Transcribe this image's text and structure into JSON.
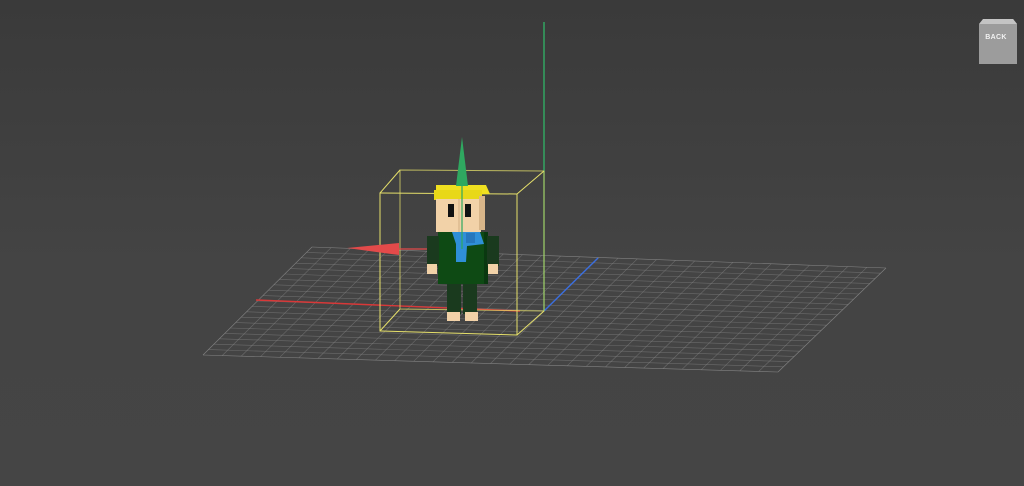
{
  "viewcube": {
    "face_label": "BACK"
  },
  "scene": {
    "character": "blocky-boy-character",
    "colors": {
      "background": "#414141",
      "grid": "#8a8a8a",
      "x_axis": "#e03a3a",
      "y_axis": "#3a6ee0",
      "z_axis": "#2fbf6a",
      "selection_box": "#e6e06a",
      "hair": "#f0e020",
      "skin": "#f2d2a8",
      "shirt": "#0e4a14",
      "scarf": "#2f8fd8",
      "pants": "#1a3a1e",
      "gizmo_z": "#2fa860",
      "gizmo_x": "#e34a4a"
    }
  }
}
